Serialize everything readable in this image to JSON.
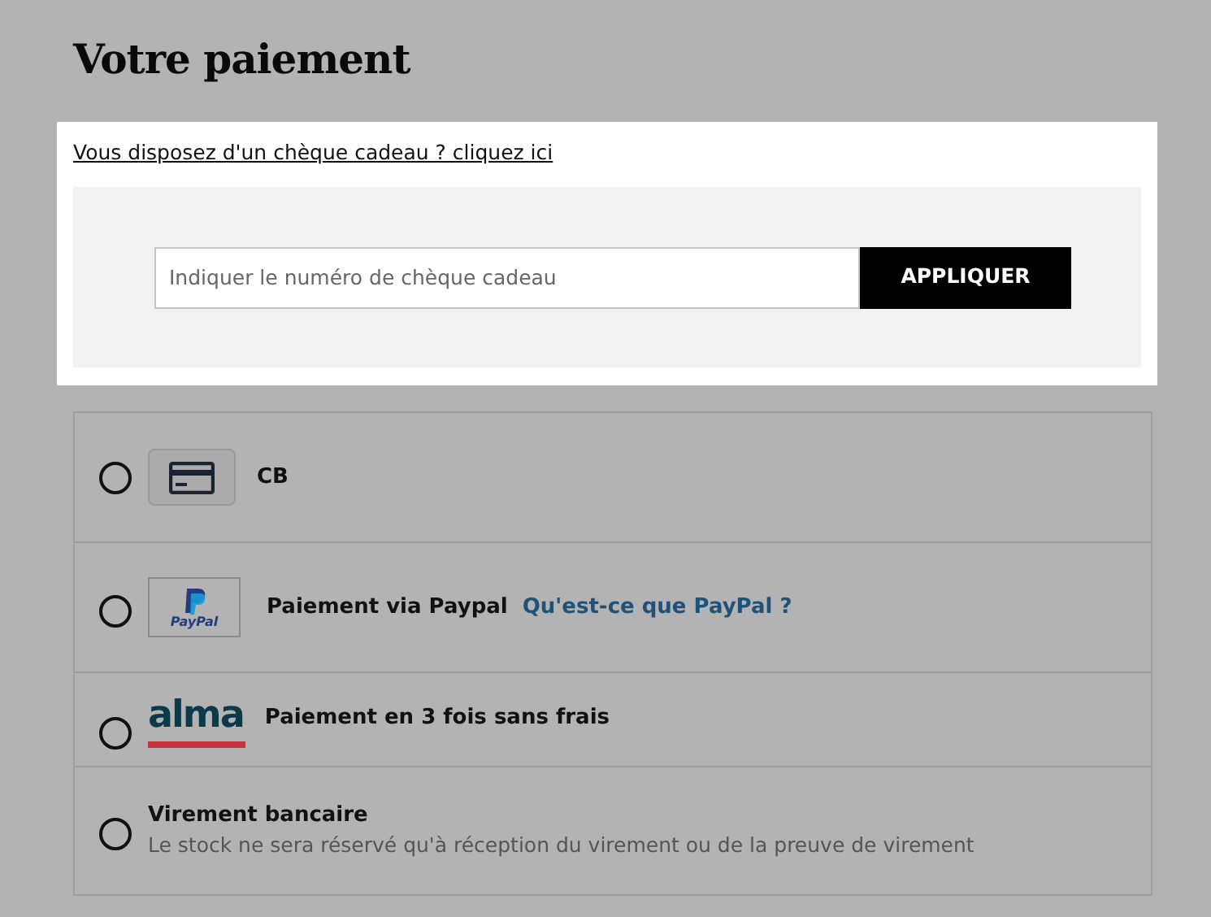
{
  "title": "Votre paiement",
  "gift": {
    "link": "Vous disposez d'un chèque cadeau ? cliquez ici",
    "placeholder": "Indiquer le numéro de chèque cadeau",
    "button": "APPLIQUER"
  },
  "methods": [
    {
      "kind": "card",
      "label": "CB",
      "selected": false
    },
    {
      "kind": "paypal",
      "logo_text": "PayPal",
      "label": "Paiement via Paypal",
      "link": "Qu'est-ce que PayPal ?",
      "selected": false
    },
    {
      "kind": "alma",
      "logo_text": "alma",
      "label": "Paiement en 3 fois sans frais",
      "selected": false
    },
    {
      "kind": "transfer",
      "label": "Virement bancaire",
      "note": "Le stock ne sera réservé qu'à réception du virement ou de la preuve de virement",
      "selected": false
    }
  ]
}
